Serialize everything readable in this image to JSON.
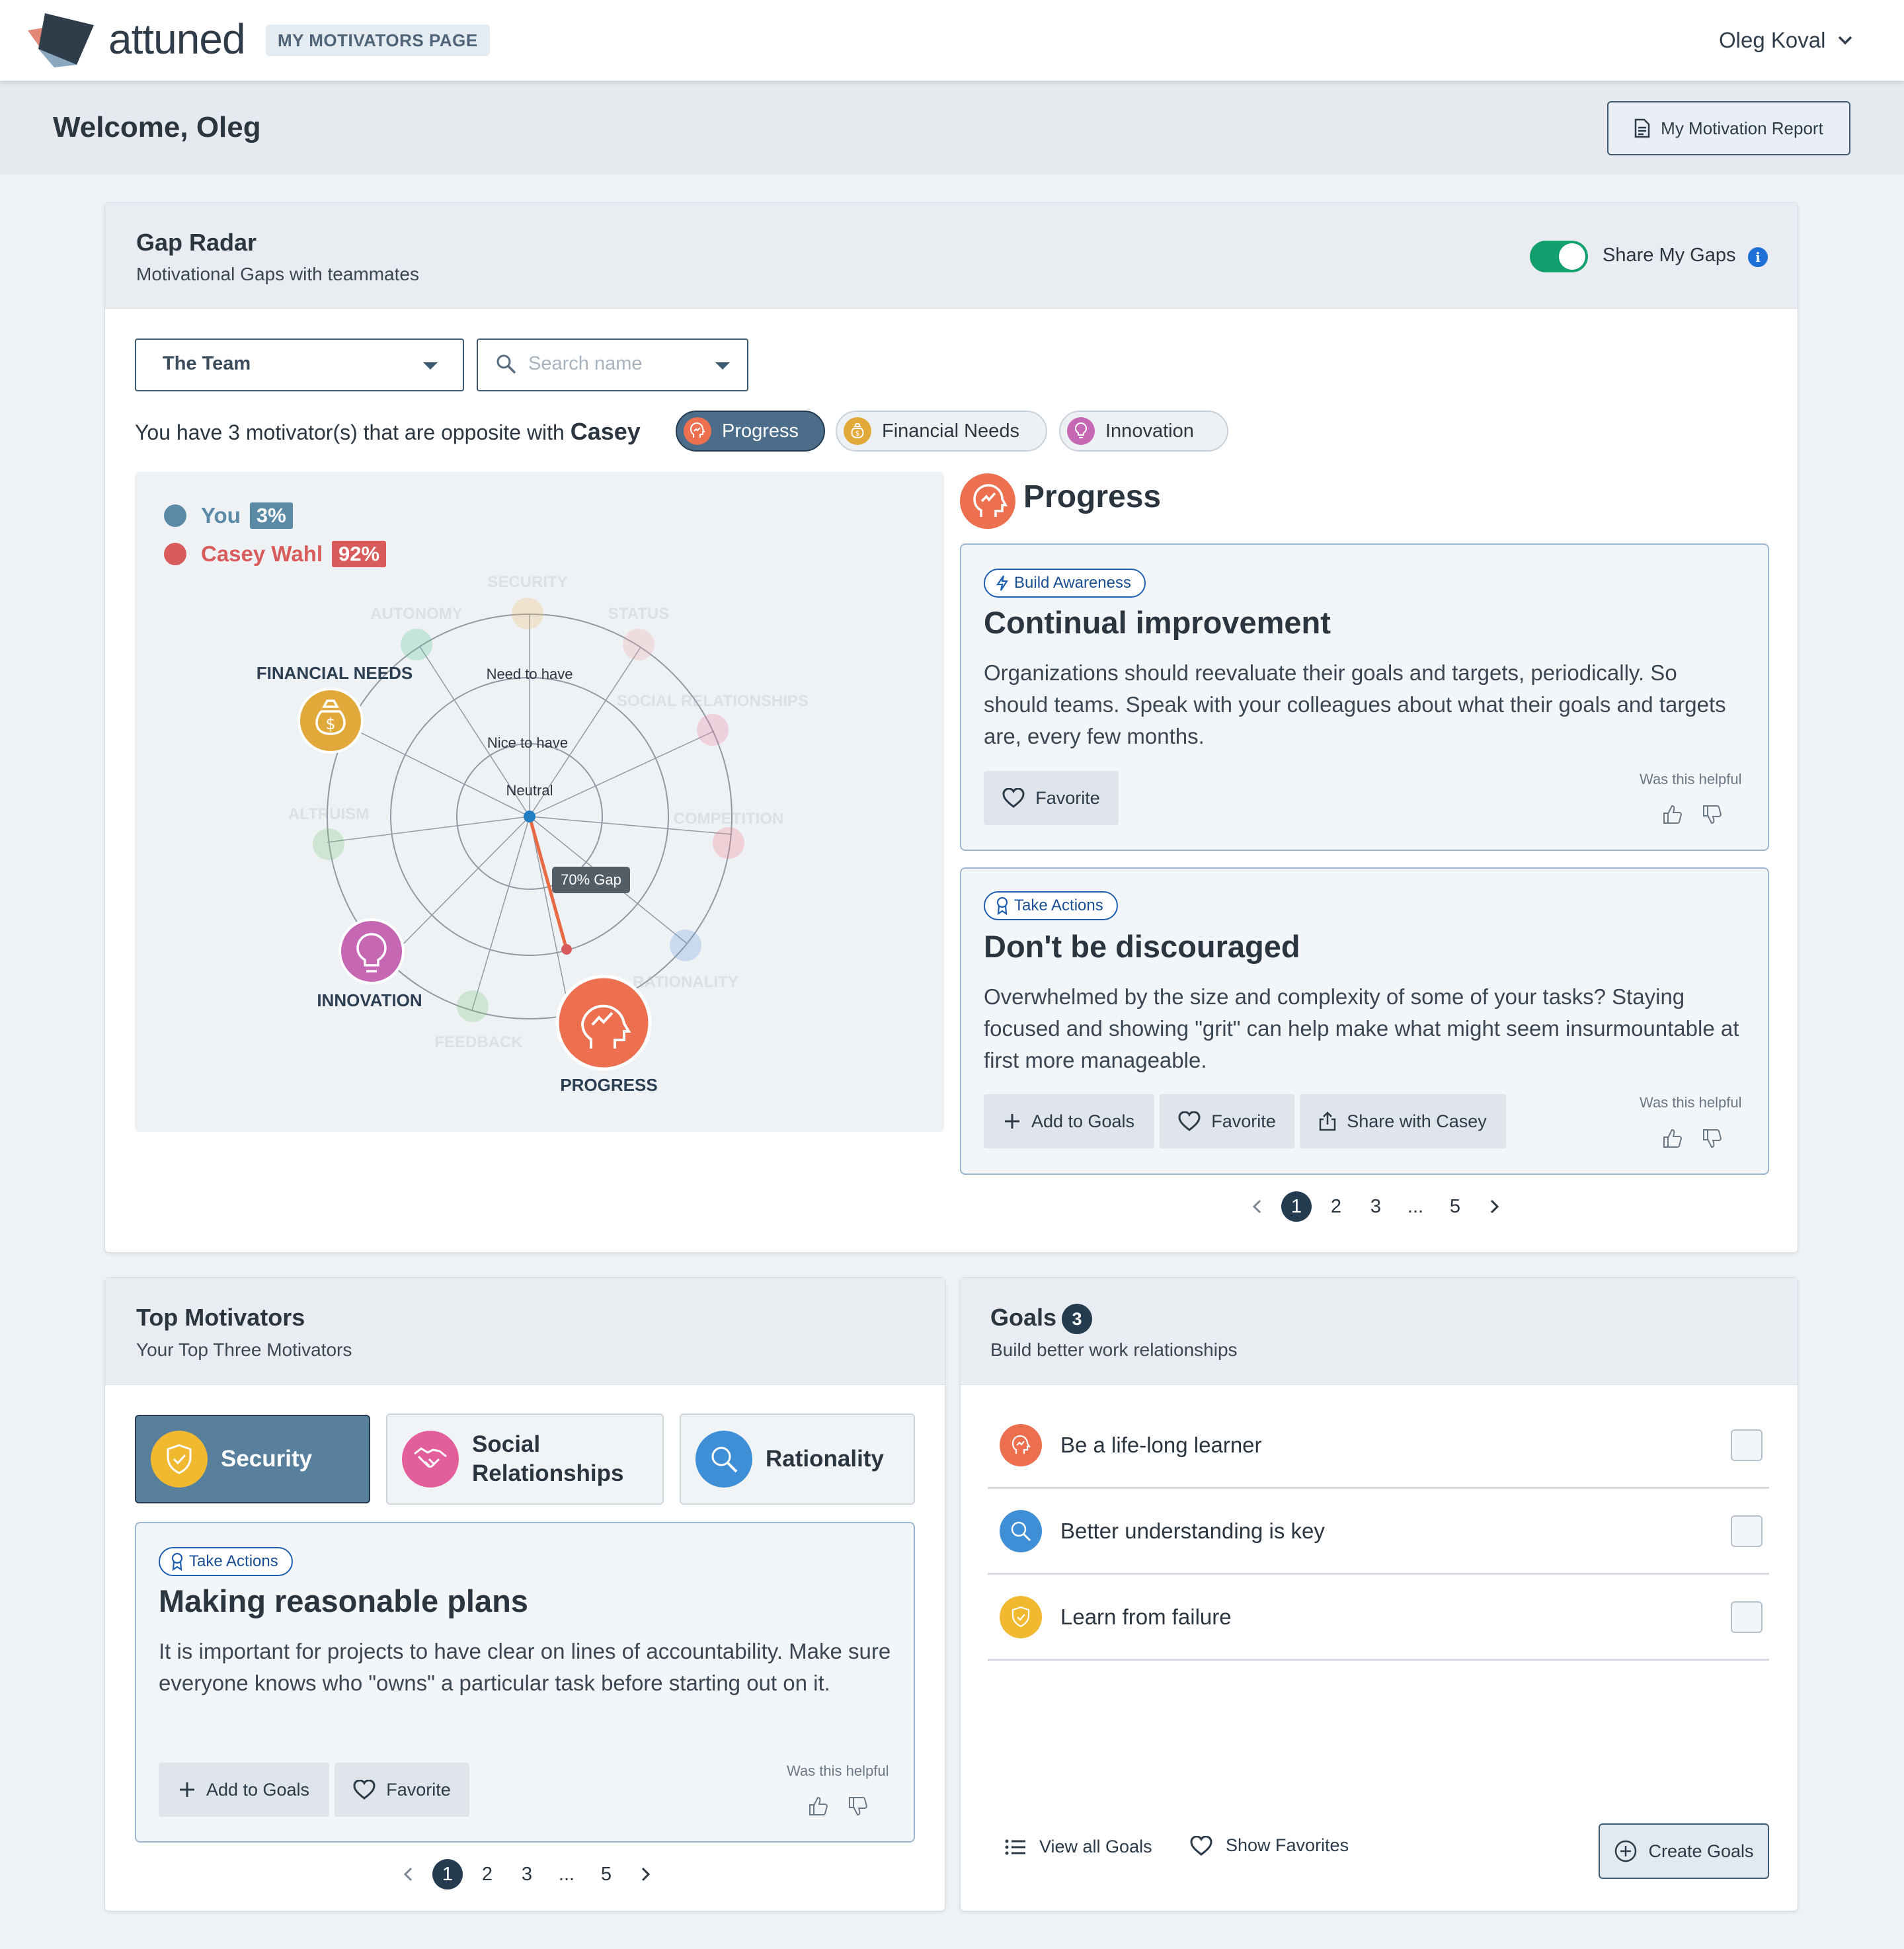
{
  "header": {
    "brand": "attuned",
    "page_tag": "MY MOTIVATORS PAGE",
    "user_name": "Oleg Koval",
    "welcome": "Welcome, Oleg",
    "report_button": "My Motivation Report"
  },
  "gap_radar": {
    "title": "Gap Radar",
    "subtitle": "Motivational Gaps with teammates",
    "share_label": "Share My Gaps",
    "share_enabled": true,
    "team_select": "The Team",
    "search_placeholder": "Search name",
    "opposite_prefix": "You have 3 motivator(s) that are opposite with",
    "opposite_name": "Casey",
    "chips": [
      "Progress",
      "Financial Needs",
      "Innovation"
    ],
    "legend": [
      {
        "name": "You",
        "pct": "3%",
        "color": "#5b8aa6"
      },
      {
        "name": "Casey Wahl",
        "pct": "92%",
        "color": "#d85c5c"
      }
    ],
    "rings": [
      "Need to have",
      "Nice to have",
      "Neutral"
    ],
    "faded_axes": [
      "SECURITY",
      "AUTONOMY",
      "STATUS",
      "SOCIAL RELATIONSHIPS",
      "ALTRUISM",
      "COMPETITION",
      "RATIONALITY",
      "FEEDBACK"
    ],
    "highlighted_axes": [
      "FINANCIAL NEEDS",
      "INNOVATION",
      "PROGRESS"
    ],
    "gap_label": "70% Gap"
  },
  "tips": {
    "motivator": "Progress",
    "cards": [
      {
        "badge": "Build Awareness",
        "title": "Continual improvement",
        "body": "Organizations should reevaluate their goals and targets, periodically. So should teams. Speak with your colleagues about what their goals and targets are, every few months.",
        "buttons": [
          "Favorite"
        ],
        "helpful": "Was this helpful"
      },
      {
        "badge": "Take Actions",
        "title": "Don't be discouraged",
        "body": "Overwhelmed by the size and complexity of some of your tasks? Staying focused and showing \"grit\" can help make what might seem insurmountable at first more manageable.",
        "buttons": [
          "Add to Goals",
          "Favorite",
          "Share with Casey"
        ],
        "helpful": "Was this helpful"
      }
    ],
    "pages": [
      "1",
      "2",
      "3",
      "...",
      "5"
    ],
    "current_page": "1"
  },
  "top_motivators": {
    "title": "Top Motivators",
    "subtitle": "Your Top Three Motivators",
    "tabs": [
      "Security",
      "Social Relationships",
      "Rationality"
    ],
    "selected": "Security",
    "card": {
      "badge": "Take Actions",
      "title": "Making reasonable plans",
      "body": "It is important for projects to have clear on lines of accountability. Make sure everyone knows who \"owns\" a particular task before starting out on it.",
      "buttons": [
        "Add to Goals",
        "Favorite"
      ],
      "helpful": "Was this helpful"
    },
    "pages": [
      "1",
      "2",
      "3",
      "...",
      "5"
    ],
    "current_page": "1"
  },
  "goals": {
    "title": "Goals",
    "count": "3",
    "subtitle": "Build better work relationships",
    "items": [
      "Be a life-long learner",
      "Better understanding is key",
      "Learn from failure"
    ],
    "view_all": "View all Goals",
    "show_favorites": "Show Favorites",
    "create": "Create Goals"
  },
  "colors": {
    "progress": "#ec7050",
    "financial": "#e0a93a",
    "innovation": "#c667b4",
    "security": "#f0b92f",
    "social": "#e35f9b",
    "rationality": "#3f8fd6",
    "toggle": "#14a06e",
    "navy": "#253b50"
  }
}
